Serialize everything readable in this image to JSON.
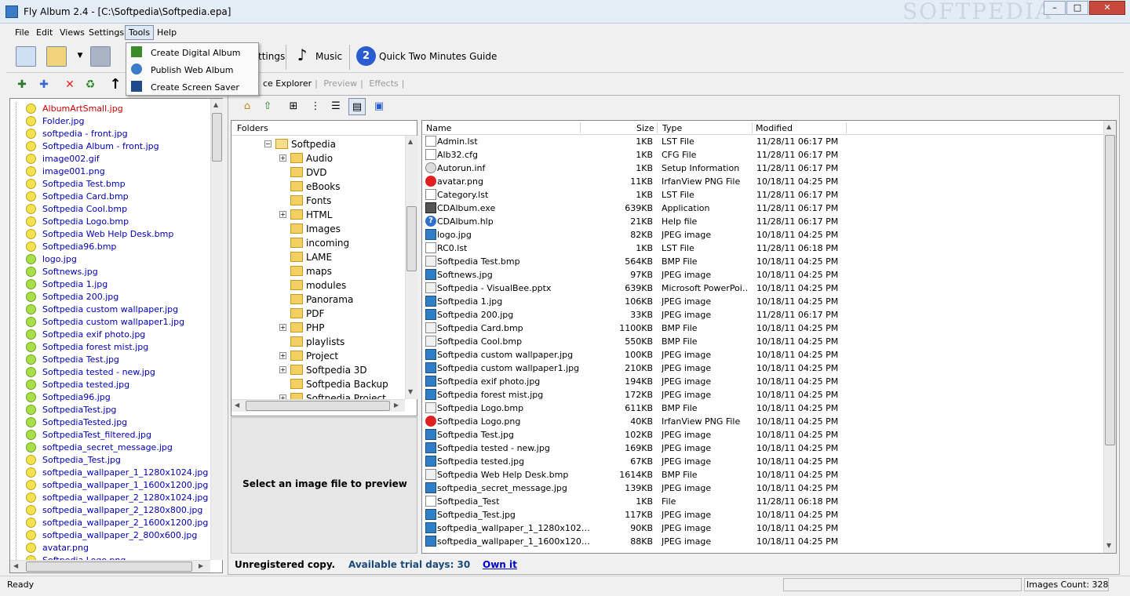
{
  "window": {
    "title": "Fly Album 2.4 - [C:\\Softpedia\\Softpedia.epa]",
    "watermark": "SOFTPEDIA",
    "buttons": {
      "minimize": "–",
      "maximize": "□",
      "close": "✕"
    }
  },
  "menu": {
    "items": [
      "File",
      "Edit",
      "Views",
      "Settings",
      "Tools",
      "Help"
    ],
    "active": "Tools",
    "tools_dropdown": [
      "Create Digital Album",
      "Publish Web Album",
      "Create Screen Saver"
    ]
  },
  "toolbar": {
    "settings_label": "ttings",
    "music_label": "Music",
    "guide_label": "Quick Two Minutes Guide",
    "guide_number": "2"
  },
  "tabs": {
    "explorer": "ce Explorer",
    "preview": "Preview",
    "effects": "Effects"
  },
  "left_files": [
    {
      "name": "AlbumArtSmall.jpg",
      "color": "red",
      "dot": "y"
    },
    {
      "name": "Folder.jpg",
      "color": "blue",
      "dot": "y"
    },
    {
      "name": "softpedia - front.jpg",
      "color": "blue",
      "dot": "y"
    },
    {
      "name": "Softpedia Album - front.jpg",
      "color": "blue",
      "dot": "y"
    },
    {
      "name": "image002.gif",
      "color": "blue",
      "dot": "y"
    },
    {
      "name": "image001.png",
      "color": "blue",
      "dot": "y"
    },
    {
      "name": "Softpedia Test.bmp",
      "color": "blue",
      "dot": "y"
    },
    {
      "name": "Softpedia Card.bmp",
      "color": "blue",
      "dot": "y"
    },
    {
      "name": "Softpedia Cool.bmp",
      "color": "blue",
      "dot": "y"
    },
    {
      "name": "Softpedia Logo.bmp",
      "color": "blue",
      "dot": "y"
    },
    {
      "name": "Softpedia Web Help Desk.bmp",
      "color": "blue",
      "dot": "y"
    },
    {
      "name": "Softpedia96.bmp",
      "color": "blue",
      "dot": "y"
    },
    {
      "name": "logo.jpg",
      "color": "blue",
      "dot": "g"
    },
    {
      "name": "Softnews.jpg",
      "color": "blue",
      "dot": "g"
    },
    {
      "name": "Softpedia 1.jpg",
      "color": "blue",
      "dot": "g"
    },
    {
      "name": "Softpedia 200.jpg",
      "color": "blue",
      "dot": "g"
    },
    {
      "name": "Softpedia custom wallpaper.jpg",
      "color": "blue",
      "dot": "g"
    },
    {
      "name": "Softpedia custom wallpaper1.jpg",
      "color": "blue",
      "dot": "g"
    },
    {
      "name": "Softpedia exif photo.jpg",
      "color": "blue",
      "dot": "g"
    },
    {
      "name": "Softpedia forest mist.jpg",
      "color": "blue",
      "dot": "g"
    },
    {
      "name": "Softpedia Test.jpg",
      "color": "blue",
      "dot": "g"
    },
    {
      "name": "Softpedia tested - new.jpg",
      "color": "blue",
      "dot": "g"
    },
    {
      "name": "Softpedia tested.jpg",
      "color": "blue",
      "dot": "g"
    },
    {
      "name": "Softpedia96.jpg",
      "color": "blue",
      "dot": "g"
    },
    {
      "name": "SoftpediaTest.jpg",
      "color": "blue",
      "dot": "g"
    },
    {
      "name": "SoftpediaTested.jpg",
      "color": "blue",
      "dot": "g"
    },
    {
      "name": "SoftpediaTest_filtered.jpg",
      "color": "blue",
      "dot": "g"
    },
    {
      "name": "softpedia_secret_message.jpg",
      "color": "blue",
      "dot": "g"
    },
    {
      "name": "Softpedia_Test.jpg",
      "color": "blue",
      "dot": "y"
    },
    {
      "name": "softpedia_wallpaper_1_1280x1024.jpg",
      "color": "blue",
      "dot": "y"
    },
    {
      "name": "softpedia_wallpaper_1_1600x1200.jpg",
      "color": "blue",
      "dot": "y"
    },
    {
      "name": "softpedia_wallpaper_2_1280x1024.jpg",
      "color": "blue",
      "dot": "y"
    },
    {
      "name": "softpedia_wallpaper_2_1280x800.jpg",
      "color": "blue",
      "dot": "y"
    },
    {
      "name": "softpedia_wallpaper_2_1600x1200.jpg",
      "color": "blue",
      "dot": "y"
    },
    {
      "name": "softpedia_wallpaper_2_800x600.jpg",
      "color": "blue",
      "dot": "y"
    },
    {
      "name": "avatar.png",
      "color": "blue",
      "dot": "y"
    },
    {
      "name": "Softpedia Logo.png",
      "color": "blue",
      "dot": "y"
    }
  ],
  "folders": {
    "header": "Folders",
    "root": "Softpedia",
    "items": [
      {
        "name": "Audio",
        "expandable": true
      },
      {
        "name": "DVD",
        "expandable": false
      },
      {
        "name": "eBooks",
        "expandable": false
      },
      {
        "name": "Fonts",
        "expandable": false
      },
      {
        "name": "HTML",
        "expandable": true
      },
      {
        "name": "Images",
        "expandable": false
      },
      {
        "name": "incoming",
        "expandable": false
      },
      {
        "name": "LAME",
        "expandable": false
      },
      {
        "name": "maps",
        "expandable": false
      },
      {
        "name": "modules",
        "expandable": false
      },
      {
        "name": "Panorama",
        "expandable": false
      },
      {
        "name": "PDF",
        "expandable": false
      },
      {
        "name": "PHP",
        "expandable": true
      },
      {
        "name": "playlists",
        "expandable": false
      },
      {
        "name": "Project",
        "expandable": true
      },
      {
        "name": "Softpedia 3D",
        "expandable": true
      },
      {
        "name": "Softpedia Backup",
        "expandable": false
      },
      {
        "name": "Softpedia Project",
        "expandable": true
      }
    ]
  },
  "preview": {
    "message": "Select an image file to preview"
  },
  "file_list": {
    "columns": [
      "Name",
      "Size",
      "Type",
      "Modified"
    ],
    "rows": [
      {
        "name": "Admin.lst",
        "size": "1KB",
        "type": "LST File",
        "modified": "11/28/11 06:17 PM",
        "icon": "doc"
      },
      {
        "name": "Alb32.cfg",
        "size": "1KB",
        "type": "CFG File",
        "modified": "11/28/11 06:17 PM",
        "icon": "doc"
      },
      {
        "name": "Autorun.inf",
        "size": "1KB",
        "type": "Setup Information",
        "modified": "11/28/11 06:17 PM",
        "icon": "gear"
      },
      {
        "name": "avatar.png",
        "size": "11KB",
        "type": "IrfanView PNG File",
        "modified": "10/18/11 04:25 PM",
        "icon": "red"
      },
      {
        "name": "Category.lst",
        "size": "1KB",
        "type": "LST File",
        "modified": "11/28/11 06:17 PM",
        "icon": "doc"
      },
      {
        "name": "CDAlbum.exe",
        "size": "639KB",
        "type": "Application",
        "modified": "11/28/11 06:17 PM",
        "icon": "app"
      },
      {
        "name": "CDAlbum.hlp",
        "size": "21KB",
        "type": "Help file",
        "modified": "11/28/11 06:17 PM",
        "icon": "help"
      },
      {
        "name": "logo.jpg",
        "size": "82KB",
        "type": "JPEG image",
        "modified": "10/18/11 04:25 PM",
        "icon": "img"
      },
      {
        "name": "RC0.lst",
        "size": "1KB",
        "type": "LST File",
        "modified": "11/28/11 06:18 PM",
        "icon": "doc"
      },
      {
        "name": "Softpedia Test.bmp",
        "size": "564KB",
        "type": "BMP File",
        "modified": "10/18/11 04:25 PM",
        "icon": "bmp"
      },
      {
        "name": "Softnews.jpg",
        "size": "97KB",
        "type": "JPEG image",
        "modified": "10/18/11 04:25 PM",
        "icon": "img"
      },
      {
        "name": "Softpedia - VisualBee.pptx",
        "size": "639KB",
        "type": "Microsoft PowerPoi…",
        "modified": "10/18/11 04:25 PM",
        "icon": "bmp"
      },
      {
        "name": "Softpedia 1.jpg",
        "size": "106KB",
        "type": "JPEG image",
        "modified": "10/18/11 04:25 PM",
        "icon": "img"
      },
      {
        "name": "Softpedia 200.jpg",
        "size": "33KB",
        "type": "JPEG image",
        "modified": "11/28/11 06:17 PM",
        "icon": "img"
      },
      {
        "name": "Softpedia Card.bmp",
        "size": "1100KB",
        "type": "BMP File",
        "modified": "10/18/11 04:25 PM",
        "icon": "bmp"
      },
      {
        "name": "Softpedia Cool.bmp",
        "size": "550KB",
        "type": "BMP File",
        "modified": "10/18/11 04:25 PM",
        "icon": "bmp"
      },
      {
        "name": "Softpedia custom wallpaper.jpg",
        "size": "100KB",
        "type": "JPEG image",
        "modified": "10/18/11 04:25 PM",
        "icon": "img"
      },
      {
        "name": "Softpedia custom wallpaper1.jpg",
        "size": "210KB",
        "type": "JPEG image",
        "modified": "10/18/11 04:25 PM",
        "icon": "img"
      },
      {
        "name": "Softpedia exif photo.jpg",
        "size": "194KB",
        "type": "JPEG image",
        "modified": "10/18/11 04:25 PM",
        "icon": "img"
      },
      {
        "name": "Softpedia forest mist.jpg",
        "size": "172KB",
        "type": "JPEG image",
        "modified": "10/18/11 04:25 PM",
        "icon": "img"
      },
      {
        "name": "Softpedia Logo.bmp",
        "size": "611KB",
        "type": "BMP File",
        "modified": "10/18/11 04:25 PM",
        "icon": "bmp"
      },
      {
        "name": "Softpedia Logo.png",
        "size": "40KB",
        "type": "IrfanView PNG File",
        "modified": "10/18/11 04:25 PM",
        "icon": "red"
      },
      {
        "name": "Softpedia Test.jpg",
        "size": "102KB",
        "type": "JPEG image",
        "modified": "10/18/11 04:25 PM",
        "icon": "img"
      },
      {
        "name": "Softpedia tested - new.jpg",
        "size": "169KB",
        "type": "JPEG image",
        "modified": "10/18/11 04:25 PM",
        "icon": "img"
      },
      {
        "name": "Softpedia tested.jpg",
        "size": "67KB",
        "type": "JPEG image",
        "modified": "10/18/11 04:25 PM",
        "icon": "img"
      },
      {
        "name": "Softpedia Web Help Desk.bmp",
        "size": "1614KB",
        "type": "BMP File",
        "modified": "10/18/11 04:25 PM",
        "icon": "bmp"
      },
      {
        "name": "softpedia_secret_message.jpg",
        "size": "139KB",
        "type": "JPEG image",
        "modified": "10/18/11 04:25 PM",
        "icon": "img"
      },
      {
        "name": "Softpedia_Test",
        "size": "1KB",
        "type": "File",
        "modified": "11/28/11 06:18 PM",
        "icon": "doc"
      },
      {
        "name": "Softpedia_Test.jpg",
        "size": "117KB",
        "type": "JPEG image",
        "modified": "10/18/11 04:25 PM",
        "icon": "img"
      },
      {
        "name": "softpedia_wallpaper_1_1280x102…",
        "size": "90KB",
        "type": "JPEG image",
        "modified": "10/18/11 04:25 PM",
        "icon": "img"
      },
      {
        "name": "softpedia_wallpaper_1_1600x120…",
        "size": "88KB",
        "type": "JPEG image",
        "modified": "10/18/11 04:25 PM",
        "icon": "img"
      }
    ]
  },
  "bottom": {
    "unregistered": "Unregistered copy.",
    "trial": "Available trial days: 30",
    "own_it": "Own it"
  },
  "status": {
    "text": "Ready",
    "images_count": "Images Count: 328"
  }
}
